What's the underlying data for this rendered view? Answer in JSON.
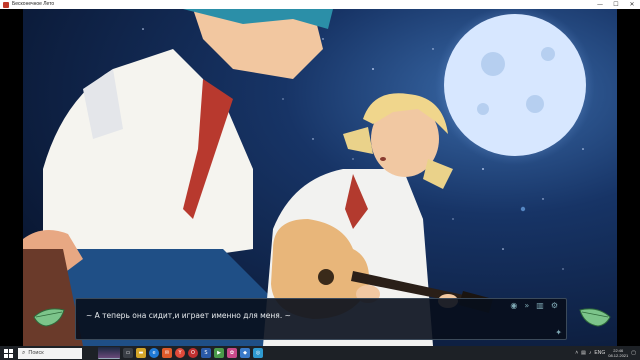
{
  "window": {
    "title": "Бесконечное Лето",
    "app_icon": "game-icon",
    "minimize": "—",
    "maximize": "☐",
    "close": "✕"
  },
  "scene": {
    "sky_color": "#0d2146",
    "moon_color": "#cfe3ff"
  },
  "dialogue": {
    "text": "~ А теперь она сидит,и играет именно для меня. ~",
    "menu_icons": [
      "eye-icon",
      "skip-icon",
      "save-icon",
      "settings-icon"
    ],
    "favorite_icon": "star-icon"
  },
  "nav": {
    "back_icon": "leaf-back-icon",
    "forward_icon": "leaf-forward-icon"
  },
  "taskbar": {
    "search_placeholder": "Поиск",
    "apps": [
      "task-view",
      "file-explorer",
      "browser",
      "mail",
      "settings",
      "steam",
      "media",
      "photos",
      "store",
      "viewer",
      "game"
    ],
    "tray": {
      "lang": "ENG",
      "time": "22:46",
      "date": "08.12.2021"
    }
  }
}
